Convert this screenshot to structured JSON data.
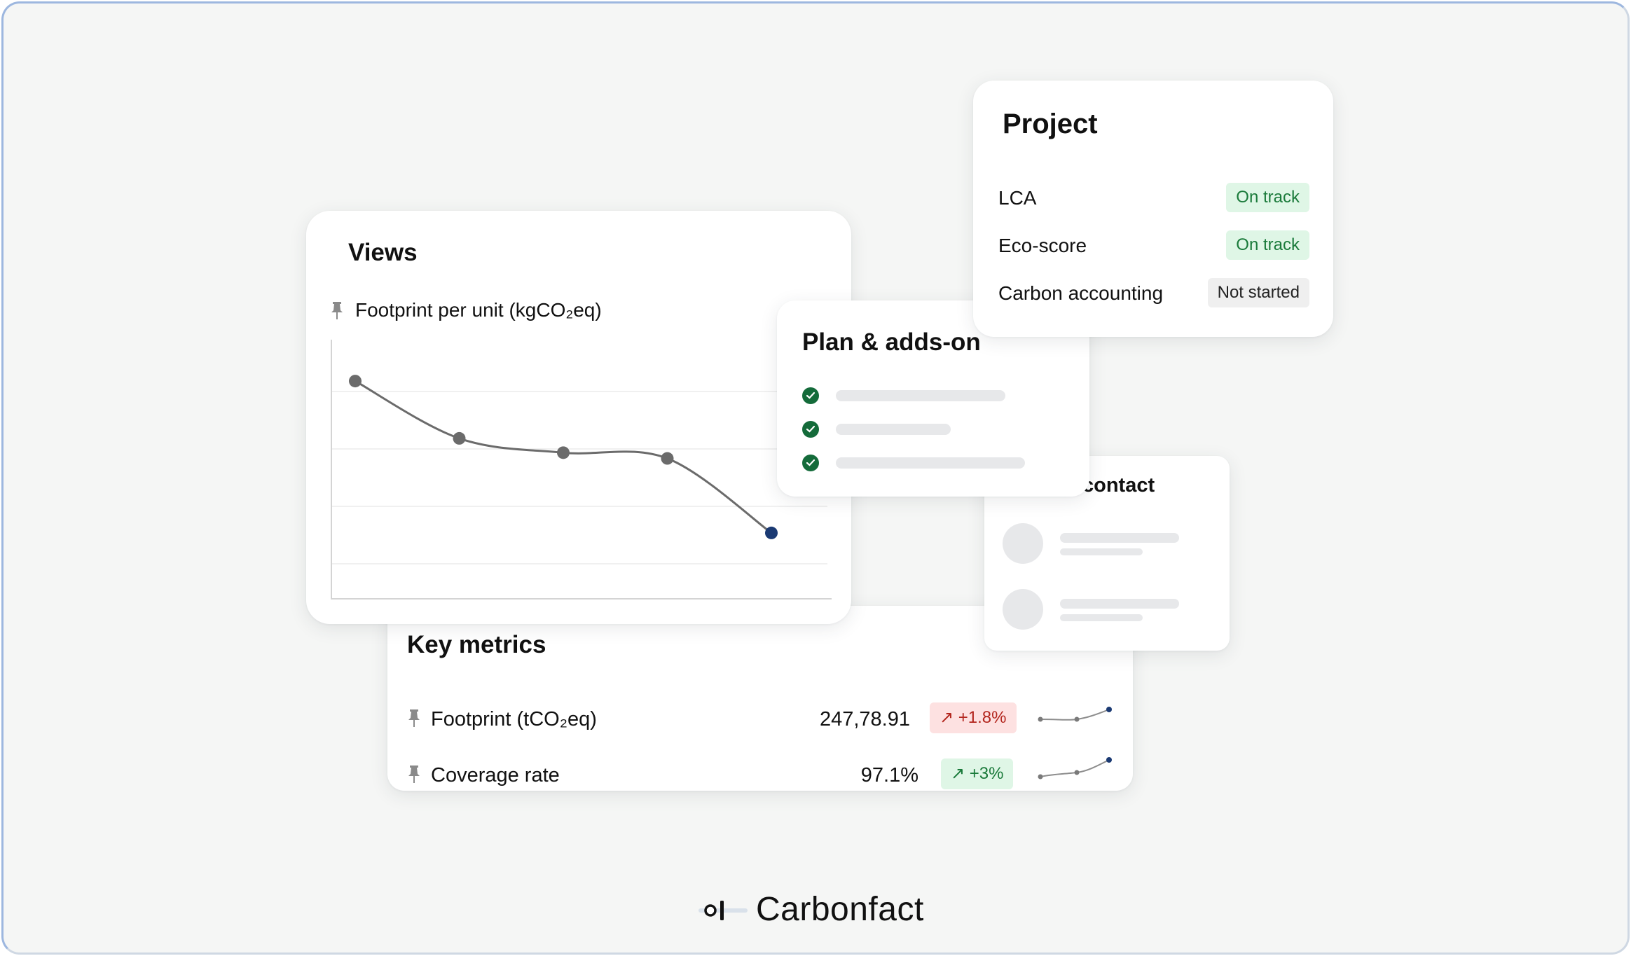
{
  "views": {
    "title": "Views",
    "series_label": "Footprint per unit (kgCO₂eq)"
  },
  "chart_data": {
    "type": "line",
    "x": [
      1,
      2,
      3,
      4,
      5
    ],
    "values": [
      3.8,
      2.8,
      2.55,
      2.45,
      1.15
    ],
    "ylim": [
      0,
      4.4
    ],
    "grid": true,
    "highlight_last_point": true,
    "colors": {
      "line": "#6b6b6b",
      "point": "#6b6b6b",
      "last_point": "#1b3a73",
      "grid": "#ececec"
    }
  },
  "plan": {
    "title": "Plan & adds-on",
    "items": 3
  },
  "project": {
    "title": "Project",
    "rows": [
      {
        "label": "LCA",
        "status": "On track",
        "kind": "ok"
      },
      {
        "label": "Eco-score",
        "status": "On track",
        "kind": "ok"
      },
      {
        "label": "Carbon accounting",
        "status": "Not started",
        "kind": "none"
      }
    ]
  },
  "contact": {
    "title": "contact"
  },
  "metrics": {
    "title": "Key metrics",
    "rows": [
      {
        "label": "Footprint (tCO₂eq)",
        "value": "247,78.91",
        "change": "↗ +1.8%",
        "trend": "up-bad",
        "spark": [
          1.0,
          1.05,
          1.6
        ]
      },
      {
        "label": "Coverage rate",
        "value": "97.1%",
        "change": "↗ +3%",
        "trend": "up-good",
        "spark": [
          1.0,
          1.15,
          1.7
        ]
      }
    ]
  },
  "brand": {
    "name": "Carbonfact",
    "accent": "#146b3a",
    "link_blue": "#1b3a73"
  }
}
